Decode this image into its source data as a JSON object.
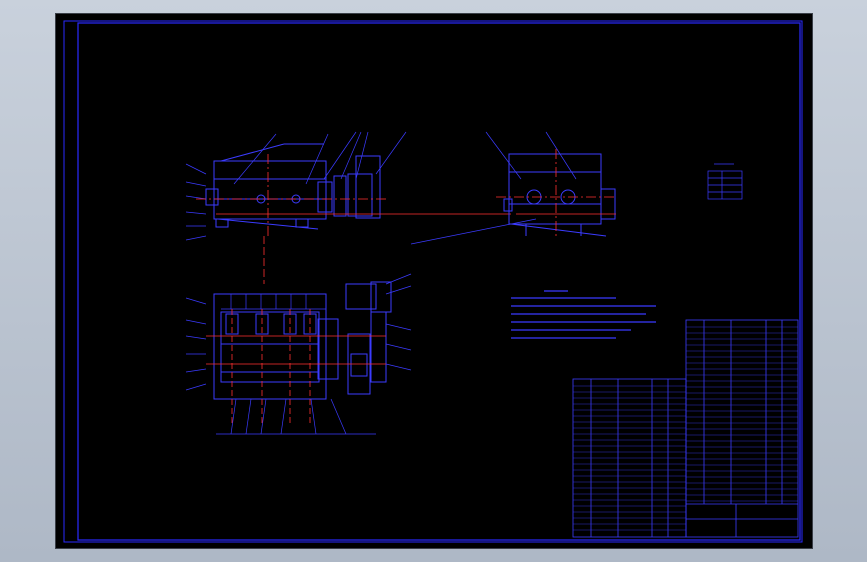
{
  "colors": {
    "background": "#000000",
    "frame": "#2a2aff",
    "geometry": "#3b3bff",
    "centerline": "#ff3030",
    "canvas_outside": "#b7c0cc"
  }
}
